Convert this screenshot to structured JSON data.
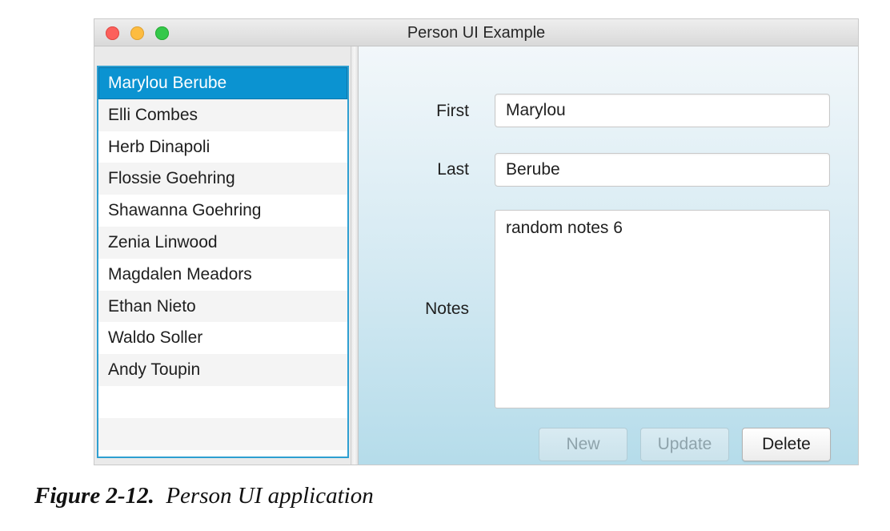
{
  "window": {
    "title": "Person UI Example"
  },
  "person_list": {
    "items": [
      {
        "name": "Marylou Berube",
        "selected": true
      },
      {
        "name": "Elli Combes",
        "selected": false
      },
      {
        "name": "Herb Dinapoli",
        "selected": false
      },
      {
        "name": "Flossie Goehring",
        "selected": false
      },
      {
        "name": "Shawanna Goehring",
        "selected": false
      },
      {
        "name": "Zenia Linwood",
        "selected": false
      },
      {
        "name": "Magdalen Meadors",
        "selected": false
      },
      {
        "name": "Ethan Nieto",
        "selected": false
      },
      {
        "name": "Waldo Soller",
        "selected": false
      },
      {
        "name": "Andy Toupin",
        "selected": false
      },
      {
        "name": "",
        "selected": false
      },
      {
        "name": "",
        "selected": false
      }
    ]
  },
  "form": {
    "first_label": "First",
    "first_value": "Marylou",
    "last_label": "Last",
    "last_value": "Berube",
    "notes_label": "Notes",
    "notes_value": "random notes 6"
  },
  "buttons": {
    "new_label": "New",
    "new_enabled": false,
    "update_label": "Update",
    "update_enabled": false,
    "delete_label": "Delete",
    "delete_enabled": true
  },
  "figure_caption": {
    "number": "Figure 2-12.",
    "text": "Person UI application"
  },
  "colors": {
    "selection": "#0b93d1",
    "list_border": "#2e9fd1",
    "close_light": "#fc605c",
    "minimize_light": "#fdbc40",
    "zoom_light": "#34c84a"
  }
}
